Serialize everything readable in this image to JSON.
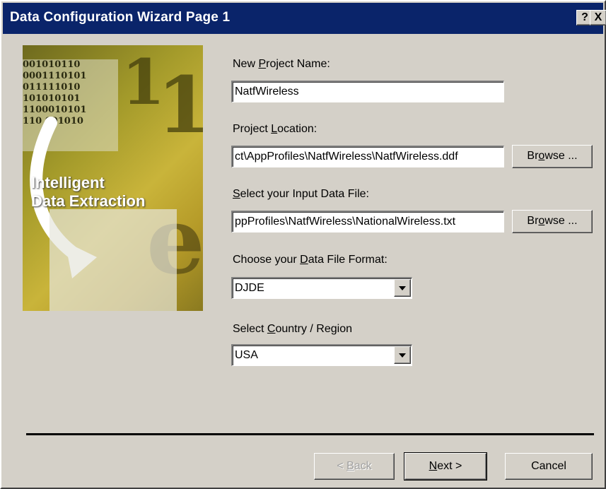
{
  "window": {
    "title": "Data Configuration Wizard Page 1",
    "help_glyph": "?",
    "close_glyph": "X"
  },
  "illustration": {
    "caption_line1": "Intelligent",
    "caption_line2": "Data Extraction"
  },
  "fields": {
    "project_name": {
      "label_pre": "New ",
      "label_key": "P",
      "label_post": "roject Name:",
      "value": "NatfWireless"
    },
    "project_location": {
      "label_pre": "Project ",
      "label_key": "L",
      "label_post": "ocation:",
      "value": "ct\\AppProfiles\\NatfWireless\\NatfWireless.ddf"
    },
    "input_file": {
      "label_pre": "",
      "label_key": "S",
      "label_post": "elect your Input Data File:",
      "value": "ppProfiles\\NatfWireless\\NationalWireless.txt"
    },
    "data_format": {
      "label_pre": "Choose your ",
      "label_key": "D",
      "label_post": "ata File Format:",
      "value": "DJDE"
    },
    "country": {
      "label_pre": "Select ",
      "label_key": "C",
      "label_post": "ountry / Region",
      "value": "USA"
    }
  },
  "browse_button": {
    "pre": "Br",
    "key": "o",
    "post": "wse ..."
  },
  "footer": {
    "back": {
      "pre": "< ",
      "key": "B",
      "post": "ack"
    },
    "next": {
      "pre": "",
      "key": "N",
      "post": "ext >"
    },
    "cancel": "Cancel"
  }
}
